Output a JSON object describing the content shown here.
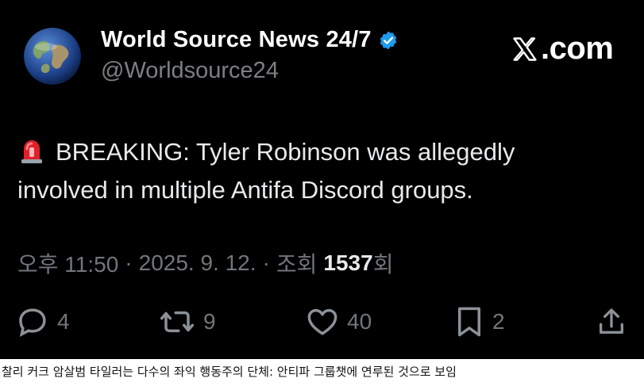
{
  "tweet": {
    "author": {
      "display_name": "World Source News 24/7",
      "handle": "@Worldsource24",
      "verified": true,
      "avatar_icon": "globe-avatar"
    },
    "brand_label": ".com",
    "brand_icon": "x-logo-icon",
    "body": {
      "emoji": "siren-icon",
      "line1": "BREAKING: Tyler Robinson was allegedly",
      "line2": "involved in multiple Antifa Discord groups."
    },
    "meta": {
      "time": "오후 11:50",
      "sep1": "·",
      "date": "2025. 9. 12.",
      "sep2": "·",
      "views_label": "조회",
      "views_count": "1537",
      "views_suffix": "회"
    },
    "actions": {
      "replies": "4",
      "reposts": "9",
      "likes": "40",
      "bookmarks": "2"
    }
  },
  "caption": "찰리 커크 암살범 타일러는 다수의 좌익 행동주의 단체: 안티파 그룹챗에 연루된 것으로 보임",
  "colors": {
    "background": "#000000",
    "text_primary": "#e7e9ea",
    "text_secondary": "#71767b",
    "verified_blue": "#1d9bf0"
  }
}
